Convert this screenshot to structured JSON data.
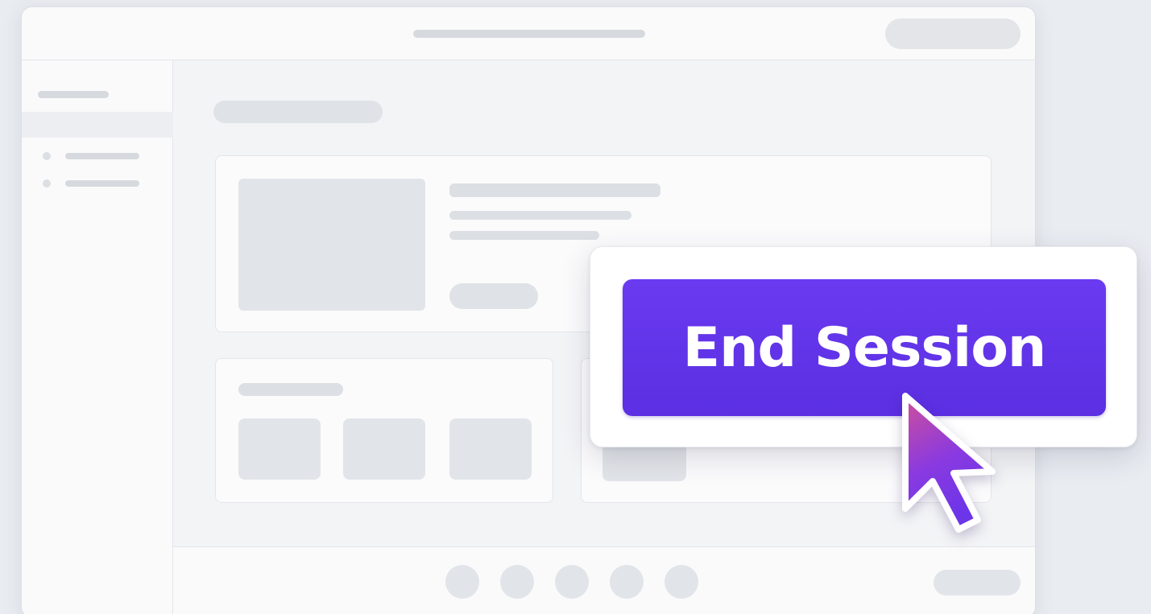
{
  "popup": {
    "end_session_label": "End Session"
  },
  "icons": {
    "cursor": "mouse-pointer-icon"
  },
  "colors": {
    "accent": "#5b2fe2",
    "accent_light": "#6a3af0",
    "cursor_gradient_top": "#d04f9a",
    "cursor_gradient_bottom": "#6b35e8",
    "background": "#e9ecf1"
  }
}
